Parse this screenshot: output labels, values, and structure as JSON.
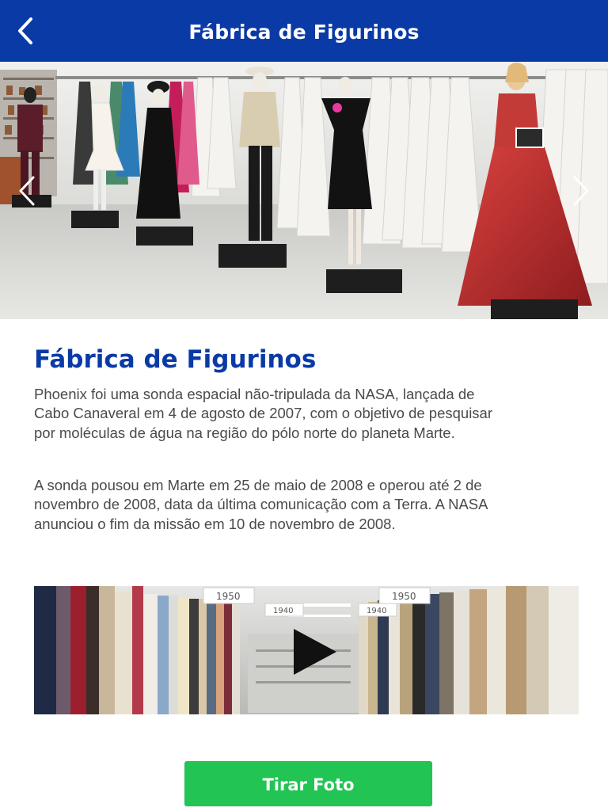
{
  "header": {
    "title": "Fábrica de Figurinos",
    "back_icon": "chevron-left-icon",
    "background_color": "#0a3aa6"
  },
  "hero": {
    "image_subject": "costume-factory-mannequins-photo",
    "prev_icon": "chevron-left-icon",
    "next_icon": "chevron-right-icon"
  },
  "article": {
    "title": "Fábrica de Figurinos",
    "paragraphs": [
      "Phoenix foi uma sonda espacial não-tripulada da NASA, lançada de Cabo Canaveral em 4 de agosto de 2007, com o objetivo de pesquisar por moléculas de água na região do pólo norte do planeta Marte.",
      "A sonda pousou em Marte em 25 de maio de 2008 e operou até 2 de novembro de 2008, data da última comunicação com a Terra. A NASA anunciou o fim da missão em 10 de novembro de 2008."
    ],
    "title_color": "#0a3aa6"
  },
  "video": {
    "thumbnail_subject": "clothing-racks-photo",
    "rack_labels": [
      "1950",
      "1940",
      "1950",
      "1940"
    ],
    "play_icon": "play-icon"
  },
  "actions": {
    "take_photo_label": "Tirar Foto",
    "take_photo_color": "#22c454"
  }
}
